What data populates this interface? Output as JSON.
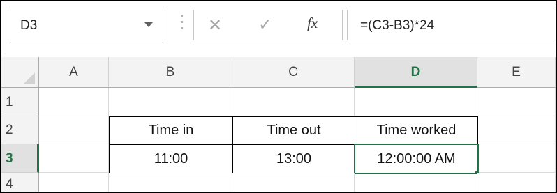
{
  "name_box": {
    "value": "D3"
  },
  "formula_bar": {
    "fx_label": "fx",
    "formula": "=(C3-B3)*24"
  },
  "columns": [
    "A",
    "B",
    "C",
    "D",
    "E"
  ],
  "rows": [
    "1",
    "2",
    "3",
    "4"
  ],
  "active_cell": {
    "column": "D",
    "row": "3"
  },
  "cells": {
    "B2": "Time in",
    "C2": "Time out",
    "D2": "Time worked",
    "B3": "11:00",
    "C3": "13:00",
    "D3": "12:00:00 AM"
  },
  "colors": {
    "selection_accent": "#217346"
  }
}
